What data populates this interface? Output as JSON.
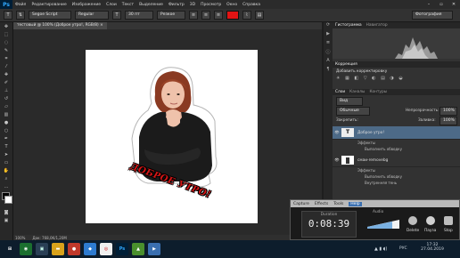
{
  "menu": {
    "logo": "Ps",
    "items": [
      "Файл",
      "Редактирование",
      "Изображение",
      "Слои",
      "Текст",
      "Выделение",
      "Фильтр",
      "3D",
      "Просмотр",
      "Окно",
      "Справка"
    ]
  },
  "options": {
    "font_family": "Segoe Script",
    "font_style": "Regular",
    "font_size": "30 пт",
    "aa": "Резкое",
    "workspace": "Фотография"
  },
  "document": {
    "tab": "тестовый @ 100% (Доброе утро!, RGB/8)",
    "caption": "ДОБРОЕ УТРО!"
  },
  "status": {
    "zoom": "100%",
    "doc_size": "Док: 768,0K/1,20M"
  },
  "panels": {
    "top_tabs": [
      "Гистограмма",
      "Навигатор"
    ],
    "adjust_tab": "Коррекция",
    "adjust_title": "Добавить корректировку",
    "layer_tabs": [
      "Слои",
      "Каналы",
      "Контуры"
    ],
    "kind": "Вид",
    "blend": "Обычные",
    "opacity_label": "Непрозрачность:",
    "opacity": "100%",
    "lock_label": "Закрепить:",
    "fill_label": "Заливка:",
    "fill": "100%",
    "layers": [
      {
        "name": "Доброе утро!",
        "effects_label": "Эффекты",
        "effects": [
          "Выполнить обводку"
        ]
      },
      {
        "name": "смаи-removebg",
        "effects_label": "Эффекты",
        "effects": [
          "Выполнить обводку",
          "Внутренняя тень"
        ]
      }
    ]
  },
  "capture": {
    "tabs": [
      "Capture",
      "Effects",
      "Tools",
      "Help"
    ],
    "duration_label": "Duration",
    "duration": "0:08:39",
    "audio_label": "Audio",
    "buttons": [
      "Delete",
      "Пауза",
      "Stop"
    ]
  },
  "taskbar": {
    "lang": "РУС",
    "time": "17:32",
    "date": "27.04.2019"
  },
  "colors": {
    "accent_red": "#e11414",
    "ps_blue": "#31a8ff",
    "panel_bg": "#323232"
  }
}
